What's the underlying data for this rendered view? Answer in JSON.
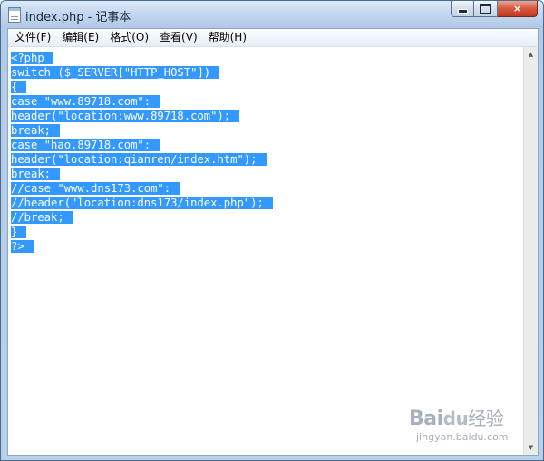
{
  "window": {
    "title": "index.php - 记事本",
    "icon": "notepad-icon",
    "controls": {
      "minimize": "minimize-icon",
      "maximize": "maximize-icon",
      "close": "×"
    }
  },
  "menubar": {
    "items": [
      {
        "label": "文件(F)"
      },
      {
        "label": "编辑(E)"
      },
      {
        "label": "格式(O)"
      },
      {
        "label": "查看(V)"
      },
      {
        "label": "帮助(H)"
      }
    ]
  },
  "editor": {
    "selection_color": "#3399ff",
    "lines": [
      "<?php",
      "switch ($_SERVER[\"HTTP_HOST\"])",
      "{",
      "case \"www.89718.com\":",
      "header(\"location:www.89718.com\");",
      "break;",
      "case \"hao.89718.com\":",
      "header(\"location:qianren/index.htm\");",
      "break;",
      "//case \"www.dns173.com\":",
      "//header(\"location:dns173/index.php\");",
      "//break;",
      "}",
      "?>"
    ]
  },
  "scrollbar": {
    "up": "▲",
    "down": "▼"
  },
  "watermark": {
    "logo_text": "Bai",
    "logo_paw": "du",
    "logo_suffix": "经验",
    "url": "jingyan.baidu.com"
  }
}
